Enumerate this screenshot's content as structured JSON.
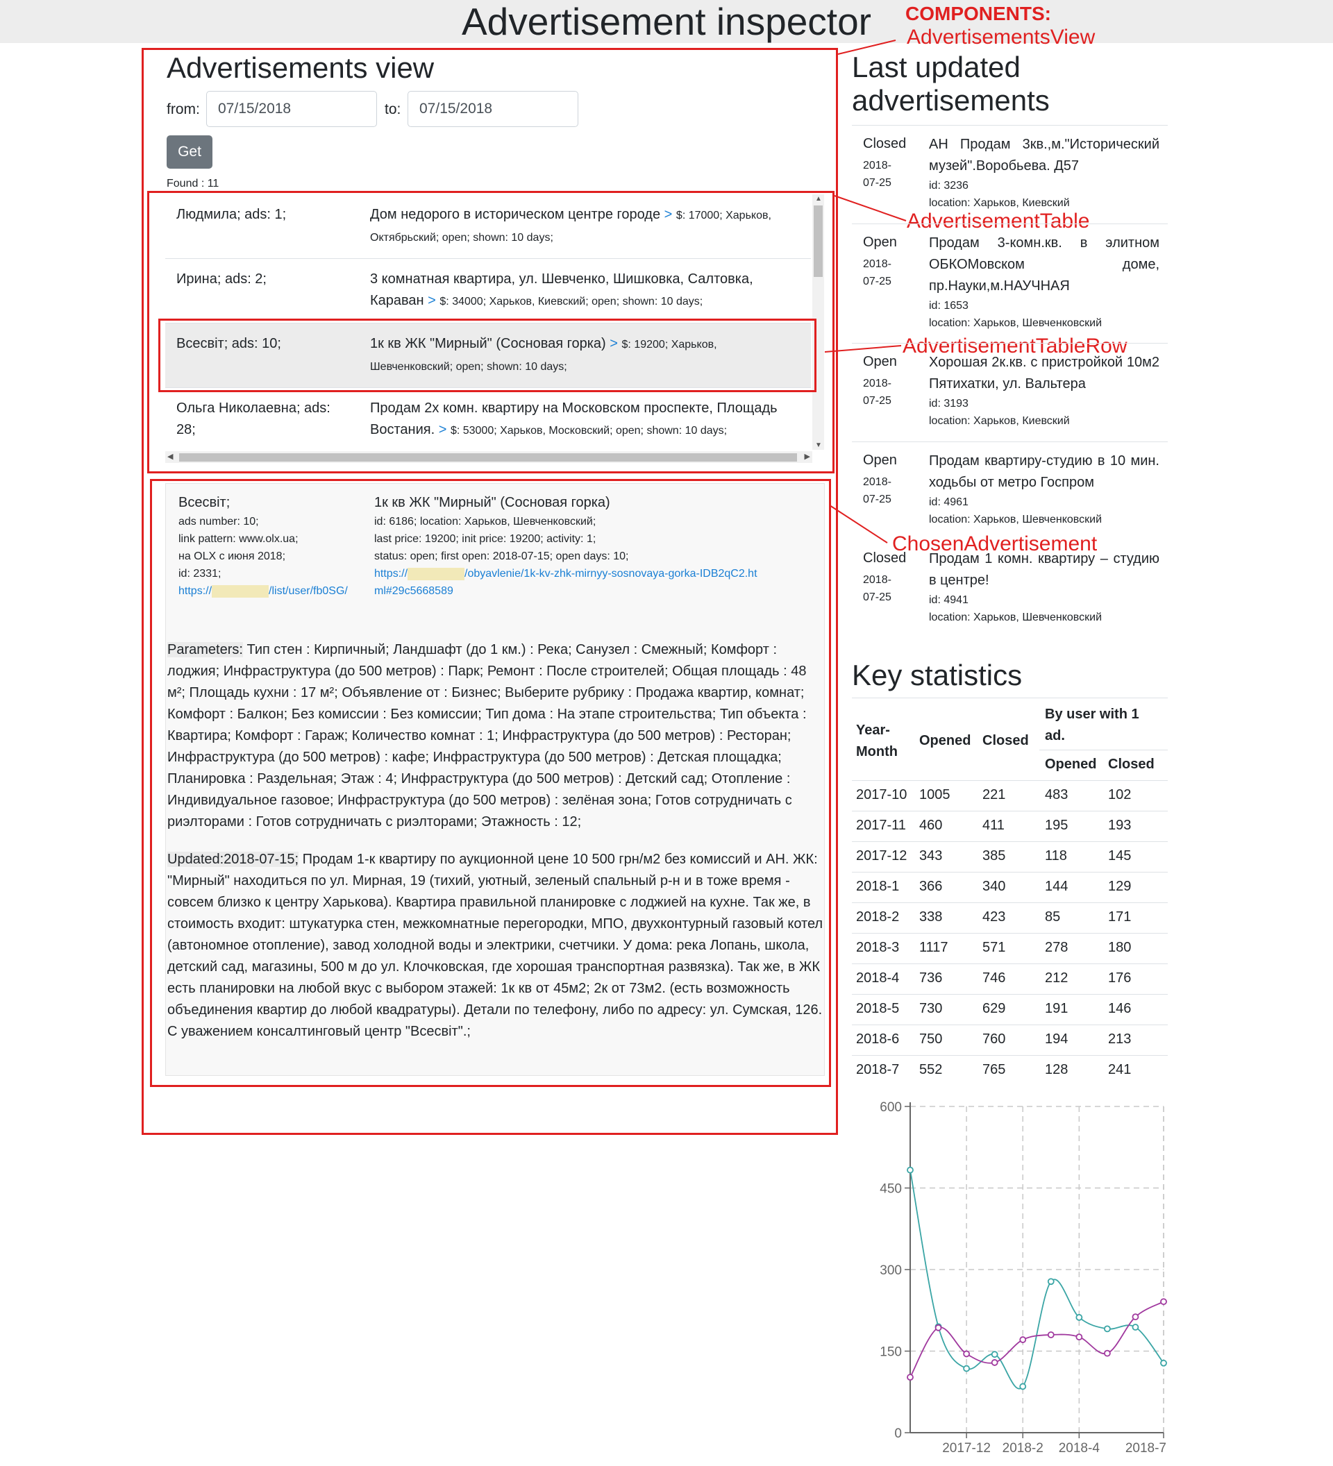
{
  "app": {
    "title": "Advertisement inspector"
  },
  "annotations": {
    "components": "COMPONENTS:",
    "ads_view": "AdvertisementsView",
    "ad_table": "AdvertisementTable",
    "ad_table_row": "AdvertisementTableRow",
    "chosen_ad": "ChosenAdvertisement",
    "color": "#e02020"
  },
  "view": {
    "title": "Advertisements view",
    "from_label": "from:",
    "from_value": "07/15/2018",
    "to_label": "to:",
    "to_value": "07/15/2018",
    "get_label": "Get",
    "found": "Found : 11"
  },
  "ad_rows": [
    {
      "name": "Людмила; ads: 1;",
      "title": "Дом недорого в историческом центре городе",
      "arrow": ">",
      "details": "$: 17000; Харьков, Октябрьский; open; shown: 10 days;"
    },
    {
      "name": "Ирина; ads: 2;",
      "title": "3 комнатная квартира, ул. Шевченко, Шишковка, Салтовка, Караван",
      "arrow": ">",
      "details": "$: 34000; Харьков, Киевский; open; shown: 10 days;"
    },
    {
      "name": "Всесвіт; ads: 10;",
      "title": "1к кв ЖК \"Мирный\" (Сосновая горка)",
      "arrow": ">",
      "details": "$: 19200; Харьков, Шевченковский; open; shown: 10 days;"
    },
    {
      "name": "Ольга Николаевна; ads: 28;",
      "title": "Продам 2х комн. квартиру на Московском проспекте, Площадь Востания.",
      "arrow": ">",
      "details": "$: 53000; Харьков, Московский; open; shown: 10 days;"
    }
  ],
  "chosen": {
    "seller_name": "Всесвіт;",
    "ads_number": "ads number: 10;",
    "link_pattern": "link pattern: www.olx.ua;",
    "on_olx": "на OLX с июня 2018;",
    "id": "id: 2331;",
    "seller_link_prefix": "https://",
    "seller_link_suffix": "/list/user/fb0SG/",
    "ad_title": "1к кв ЖК \"Мирный\" (Сосновая горка)",
    "ad_id": "id: 6186; location: Харьков, Шевченковский;",
    "prices": "last price: 19200; init price: 19200; activity: 1;",
    "status": "status: open; first open: 2018-07-15; open days: 10;",
    "ad_link_prefix": "https://",
    "ad_link_suffix": "/obyavlenie/1k-kv-zhk-mirnyy-sosnovaya-gorka-IDB2qC2.html#29c5668589",
    "params_label": "Parameters:",
    "params_text": " Тип стен : Кирпичный; Ландшафт (до 1 км.) : Река; Санузел : Смежный; Комфорт : лоджия; Инфраструктура (до 500 метров) : Парк; Ремонт : После строителей; Общая площадь : 48 м²; Площадь кухни : 17 м²; Объявление от : Бизнес; Выберите рубрику : Продажа квартир, комнат; Комфорт : Балкон; Без комиссии : Без комиссии; Тип дома : На этапе строительства; Тип объекта : Квартира; Комфорт : Гараж; Количество комнат : 1; Инфраструктура (до 500 метров) : Ресторан; Инфраструктура (до 500 метров) : кафе; Инфраструктура (до 500 метров) : Детская площадка; Планировка : Раздельная; Этаж : 4; Инфраструктура (до 500 метров) : Детский сад; Отопление : Индивидуальное газовое; Инфраструктура (до 500 метров) : зелёная зона; Готов сотрудничать с риэлторами : Готов сотрудничать с риэлторами; Этажность : 12;",
    "updated_label": "Updated:2018-07-15;",
    "updated_text": " Продам 1-к квартиру по аукционной цене 10 500 грн/м2 без комиссий и АН. ЖК: \"Мирный\" находиться по ул. Мирная, 19 (тихий, уютный, зеленый спальный р-н и в тоже время - совсем близко к центру Харькова). Квартира правильной планировке с лоджией на кухне. Так же, в стоимость входит: штукатурка стен, межкомнатные перегородки, МПО, двухконтурный газовый котел (автономное отопление), завод холодной воды и электрики, счетчики. У дома: река Лопань, школа, детский сад, магазины, 500 м до ул. Клочковская, где хорошая транспортная развязка). Так же, в ЖК есть планировки на любой вкус с выбором этажей: 1к кв от 45м2; 2к от 73м2. (есть возможность объединения квартир до любой квадратуры). Детали по телефону, либо по адресу: ул. Сумская, 126. С уважением консалтинговый центр \"Всесвіт\".;"
  },
  "last_updated": {
    "title": "Last updated advertisements",
    "items": [
      {
        "status": "Closed",
        "date": "2018-07-25",
        "title": "АН Продам 3кв.,м.\"Исторический музей\".Воробьева. Д57",
        "id": "id: 3236",
        "location": "location: Харьков, Киевский"
      },
      {
        "status": "Open",
        "date": "2018-07-25",
        "title": "Продам 3-комн.кв. в элитном ОБКОМовском доме, пр.Науки,м.НАУЧНАЯ",
        "id": "id: 1653",
        "location": "location: Харьков, Шевченковский"
      },
      {
        "status": "Open",
        "date": "2018-07-25",
        "title": "Хорошая 2к.кв. с пристройкой 10м2 Пятихатки, ул. Вальтера",
        "id": "id: 3193",
        "location": "location: Харьков, Киевский"
      },
      {
        "status": "Open",
        "date": "2018-07-25",
        "title": "Продам квартиру-студию в 10 мин. ходьбы от метро Госпром",
        "id": "id: 4961",
        "location": "location: Харьков, Шевченковский"
      },
      {
        "status": "Closed",
        "date": "2018-07-25",
        "title": "Продам 1 комн. квартиру – студию в центре!",
        "id": "id: 4941",
        "location": "location: Харьков, Шевченковский"
      }
    ]
  },
  "stats": {
    "title": "Key statistics",
    "headers": {
      "year_month": "Year-Month",
      "opened": "Opened",
      "closed": "Closed",
      "by_user": "By user with 1 ad.",
      "sub_opened": "Opened",
      "sub_closed": "Closed"
    },
    "rows": [
      [
        "2017-10",
        "1005",
        "221",
        "483",
        "102"
      ],
      [
        "2017-11",
        "460",
        "411",
        "195",
        "193"
      ],
      [
        "2017-12",
        "343",
        "385",
        "118",
        "145"
      ],
      [
        "2018-1",
        "366",
        "340",
        "144",
        "129"
      ],
      [
        "2018-2",
        "338",
        "423",
        "85",
        "171"
      ],
      [
        "2018-3",
        "1117",
        "571",
        "278",
        "180"
      ],
      [
        "2018-4",
        "736",
        "746",
        "212",
        "176"
      ],
      [
        "2018-5",
        "730",
        "629",
        "191",
        "146"
      ],
      [
        "2018-6",
        "750",
        "760",
        "194",
        "213"
      ],
      [
        "2018-7",
        "552",
        "765",
        "128",
        "241"
      ]
    ]
  },
  "chart_data": {
    "type": "line",
    "x": [
      "2017-10",
      "2017-11",
      "2017-12",
      "2018-1",
      "2018-2",
      "2018-3",
      "2018-4",
      "2018-5",
      "2018-6",
      "2018-7"
    ],
    "x_tick_labels": [
      "2017-12",
      "2018-2",
      "2018-4",
      "2018-7"
    ],
    "y_ticks": [
      "0",
      "150",
      "300",
      "450",
      "600"
    ],
    "ylim": [
      0,
      600
    ],
    "grid": true,
    "series": [
      {
        "values": [
          483,
          195,
          118,
          144,
          85,
          278,
          212,
          191,
          194,
          128
        ],
        "color": "#3aa5a5"
      },
      {
        "values": [
          102,
          193,
          145,
          129,
          171,
          180,
          176,
          146,
          213,
          241
        ],
        "color": "#a0389e"
      }
    ]
  }
}
